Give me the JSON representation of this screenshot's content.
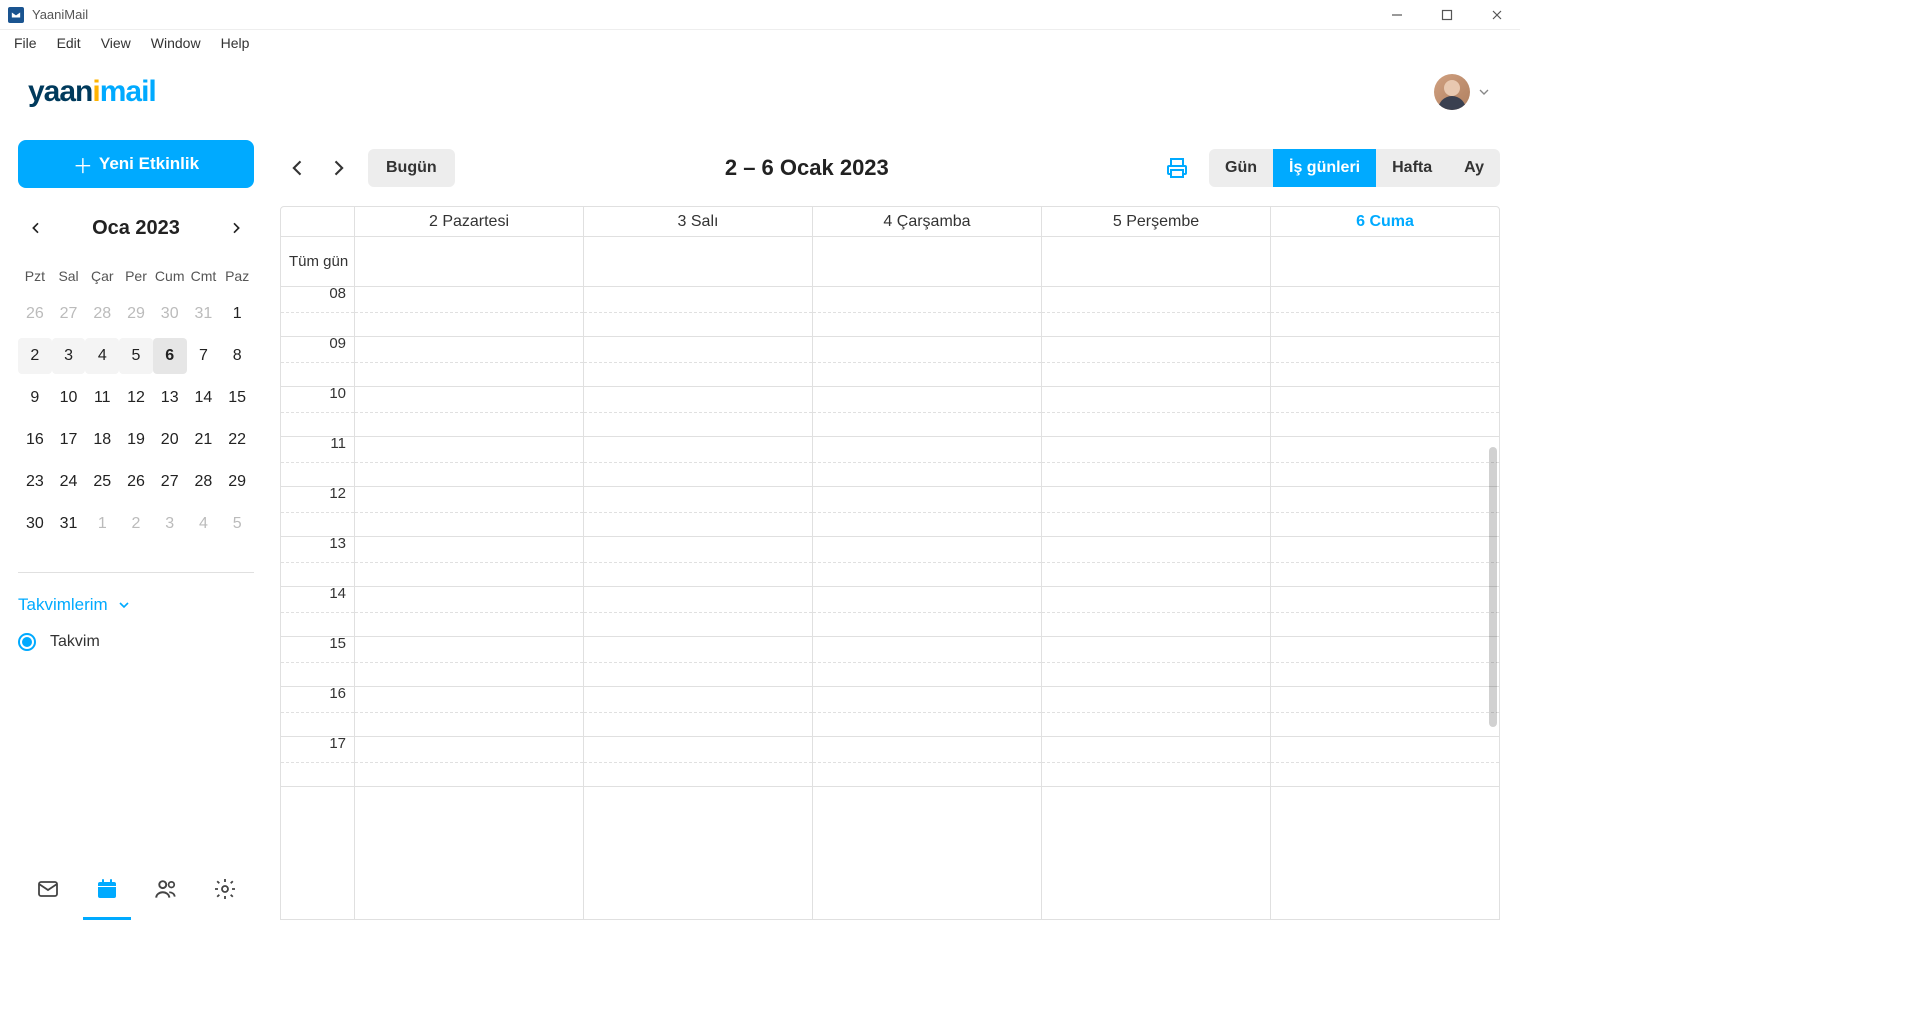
{
  "app": {
    "title": "YaaniMail"
  },
  "menubar": [
    "File",
    "Edit",
    "View",
    "Window",
    "Help"
  ],
  "logo": {
    "part1": "yaan",
    "dot": "i",
    "part2": "mail"
  },
  "sidebar": {
    "new_event": "Yeni Etkinlik",
    "mini_cal": {
      "title": "Oca  2023",
      "dow": [
        "Pzt",
        "Sal",
        "Çar",
        "Per",
        "Cum",
        "Cmt",
        "Paz"
      ],
      "weeks": [
        [
          {
            "d": "26",
            "o": true
          },
          {
            "d": "27",
            "o": true
          },
          {
            "d": "28",
            "o": true
          },
          {
            "d": "29",
            "o": true
          },
          {
            "d": "30",
            "o": true
          },
          {
            "d": "31",
            "o": true
          },
          {
            "d": "1"
          }
        ],
        [
          {
            "d": "2",
            "w": true
          },
          {
            "d": "3",
            "w": true
          },
          {
            "d": "4",
            "w": true
          },
          {
            "d": "5",
            "w": true
          },
          {
            "d": "6",
            "w": true,
            "t": true
          },
          {
            "d": "7"
          },
          {
            "d": "8"
          }
        ],
        [
          {
            "d": "9"
          },
          {
            "d": "10"
          },
          {
            "d": "11"
          },
          {
            "d": "12"
          },
          {
            "d": "13"
          },
          {
            "d": "14"
          },
          {
            "d": "15"
          }
        ],
        [
          {
            "d": "16"
          },
          {
            "d": "17"
          },
          {
            "d": "18"
          },
          {
            "d": "19"
          },
          {
            "d": "20"
          },
          {
            "d": "21"
          },
          {
            "d": "22"
          }
        ],
        [
          {
            "d": "23"
          },
          {
            "d": "24"
          },
          {
            "d": "25"
          },
          {
            "d": "26"
          },
          {
            "d": "27"
          },
          {
            "d": "28"
          },
          {
            "d": "29"
          }
        ],
        [
          {
            "d": "30"
          },
          {
            "d": "31"
          },
          {
            "d": "1",
            "o": true
          },
          {
            "d": "2",
            "o": true
          },
          {
            "d": "3",
            "o": true
          },
          {
            "d": "4",
            "o": true
          },
          {
            "d": "5",
            "o": true
          }
        ]
      ]
    },
    "calendars_label": "Takvimlerim",
    "calendar_item": "Takvim"
  },
  "toolbar": {
    "today": "Bugün",
    "range": "2 – 6 Ocak 2023",
    "views": {
      "day": "Gün",
      "work": "İş günleri",
      "week": "Hafta",
      "month": "Ay"
    }
  },
  "grid": {
    "day_headers": [
      {
        "label": "2 Pazartesi"
      },
      {
        "label": "3 Salı"
      },
      {
        "label": "4 Çarşamba"
      },
      {
        "label": "5 Perşembe"
      },
      {
        "label": "6 Cuma",
        "today": true
      }
    ],
    "allday_label": "Tüm gün",
    "hours": [
      "08",
      "09",
      "10",
      "11",
      "12",
      "13",
      "14",
      "15",
      "16",
      "17"
    ]
  }
}
